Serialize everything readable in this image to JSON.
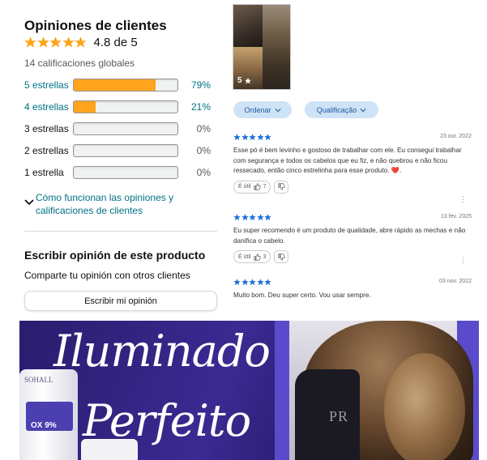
{
  "summary": {
    "title": "Opiniones de clientes",
    "average_label": "4.8 de 5",
    "average_rating": 4.8,
    "global_ratings": "14 calificaciones globales",
    "histogram": [
      {
        "label": "5 estrellas",
        "percent_label": "79%",
        "percent": 79,
        "link": true
      },
      {
        "label": "4 estrellas",
        "percent_label": "21%",
        "percent": 21,
        "link": true
      },
      {
        "label": "3 estrellas",
        "percent_label": "0%",
        "percent": 0,
        "link": false
      },
      {
        "label": "2 estrellas",
        "percent_label": "0%",
        "percent": 0,
        "link": false
      },
      {
        "label": "1 estrella",
        "percent_label": "0%",
        "percent": 0,
        "link": false
      }
    ],
    "how_it_works": "Cómo funcionan las opiniones y calificaciones de clientes"
  },
  "write_review": {
    "title": "Escribir opinión de este producto",
    "subtitle": "Comparte tu opinión con otros clientes",
    "button": "Escribir mi opinión"
  },
  "media": {
    "count": "5"
  },
  "filters": {
    "sort": "Ordenar",
    "rating": "Qualificação"
  },
  "reviews": [
    {
      "rating": 5,
      "date": "23 out. 2022",
      "text": "Esse pó é bem levinho e gostoso de trabalhar com ele. Eu consegui trabalhar com segurança e todos os cabelos que eu fiz, e não quebrou e não ficou ressecado, então cinco estrelinha para esse produto. ❤️.",
      "helpful_label": "É útil",
      "helpful_count": "7"
    },
    {
      "rating": 5,
      "date": "13 fev. 2025",
      "text": "Eu super recomendo é um produto de qualidade, abre rápido as mechas e não danifica o cabelo.",
      "helpful_label": "É útil",
      "helpful_count": "3"
    },
    {
      "rating": 5,
      "date": "03 nov. 2022",
      "text": "Muito bom. Deu super certo. Vou usar sempre."
    }
  ],
  "banner": {
    "title_line1": "Iluminado",
    "title_line2": "Perfeito",
    "bottle_brand": "SOHALL",
    "bottle_label": "OX 9%",
    "brand_mark": "PR"
  },
  "colors": {
    "star": "#ffa41c",
    "link": "#007185",
    "review_star": "#1e6fd9",
    "pill_bg": "#cfe3f6",
    "banner_purple": "#3b2a92"
  },
  "icons": {
    "star": "star-icon",
    "chevron": "chevron-down-icon",
    "thumbs_up": "thumbs-up-icon",
    "thumbs_down": "thumbs-down-icon",
    "more": "more-vertical-icon"
  }
}
